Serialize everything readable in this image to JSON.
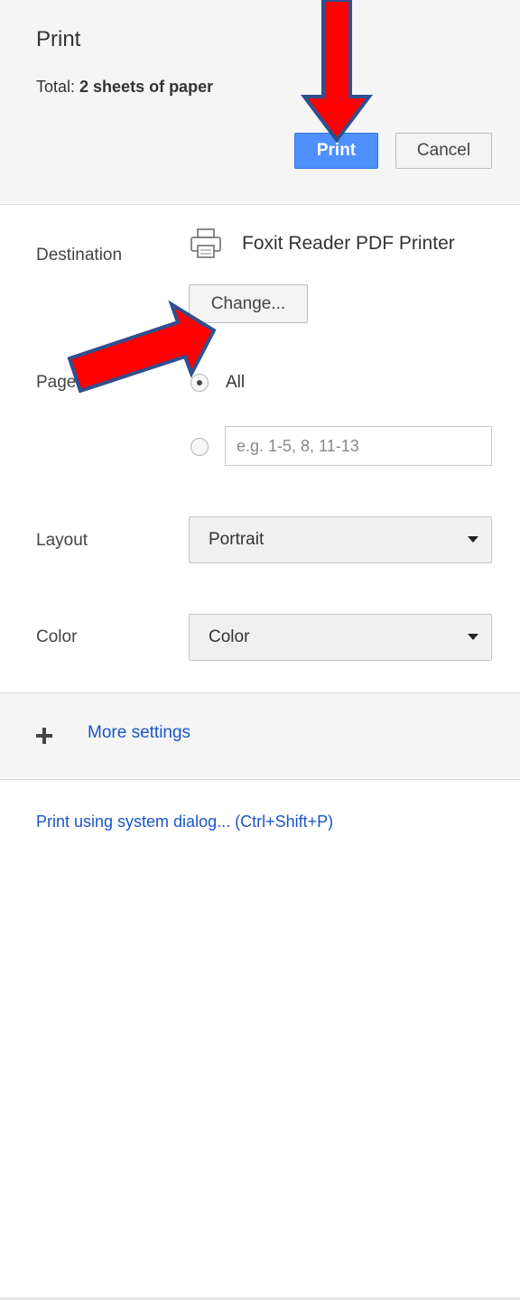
{
  "header": {
    "title": "Print",
    "total_prefix": "Total: ",
    "total_value": "2 sheets of paper",
    "print_button": "Print",
    "cancel_button": "Cancel"
  },
  "destination": {
    "label": "Destination",
    "printer_icon": "printer-icon",
    "printer_name": "Foxit Reader PDF Printer",
    "change_button": "Change..."
  },
  "pages": {
    "label": "Pages",
    "option_all": "All",
    "option_all_selected": true,
    "range_placeholder": "e.g. 1-5, 8, 11-13"
  },
  "layout": {
    "label": "Layout",
    "value": "Portrait"
  },
  "color": {
    "label": "Color",
    "value": "Color"
  },
  "more_settings": {
    "label": "More settings",
    "icon": "plus-icon"
  },
  "system_dialog_link": "Print using system dialog... (Ctrl+Shift+P)",
  "annotations": {
    "arrow_color": "#ff0000",
    "arrow_outline": "#2f4f8f"
  }
}
